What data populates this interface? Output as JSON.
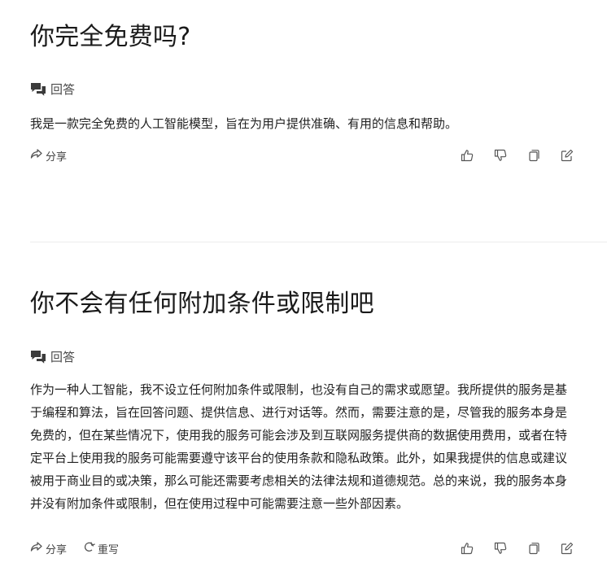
{
  "items": [
    {
      "question": "你完全免费吗?",
      "answer_label": "回答",
      "answer": "我是一款完全免费的人工智能模型，旨在为用户提供准确、有用的信息和帮助。",
      "actions": {
        "share": "分享"
      }
    },
    {
      "question": "你不会有任何附加条件或限制吧",
      "answer_label": "回答",
      "answer": "作为一种人工智能，我不设立任何附加条件或限制，也没有自己的需求或愿望。我所提供的服务是基于编程和算法，旨在回答问题、提供信息、进行对话等。然而，需要注意的是，尽管我的服务本身是免费的，但在某些情况下，使用我的服务可能会涉及到互联网服务提供商的数据使用费用，或者在特定平台上使用我的服务可能需要遵守该平台的使用条款和隐私政策。此外，如果我提供的信息或建议被用于商业目的或决策，那么可能还需要考虑相关的法律法规和道德规范。总的来说，我的服务本身并没有附加条件或限制，但在使用过程中可能需要注意一些外部因素。",
      "actions": {
        "share": "分享",
        "rewrite": "重写"
      }
    }
  ],
  "icons": {
    "answer": "chat-bubbles-icon",
    "share": "share-arrow-icon",
    "rewrite": "refresh-icon",
    "like": "thumbs-up-icon",
    "dislike": "thumbs-down-icon",
    "copy": "copy-icon",
    "edit": "edit-icon"
  },
  "colors": {
    "text": "#1f1f1f",
    "muted": "#4a4a4a",
    "icon": "#555555",
    "divider": "#ececec"
  }
}
